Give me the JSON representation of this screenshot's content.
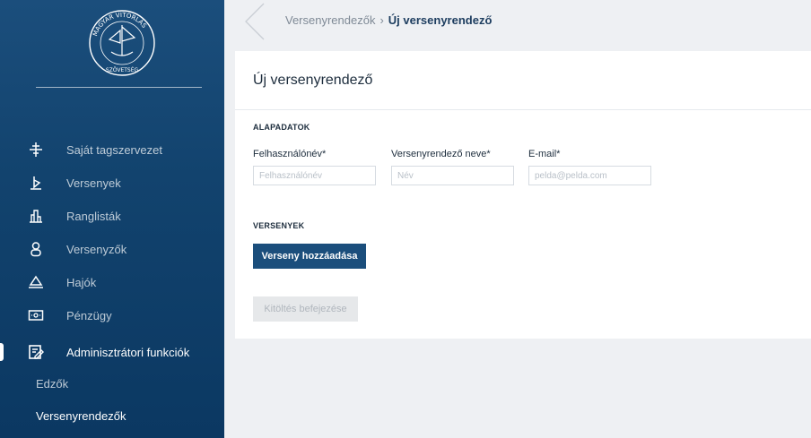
{
  "sidebar": {
    "logo_text": "MAGYAR VITORLÁS SZÖVETSÉG HUNGARIAN YACHTING",
    "items": [
      {
        "label": "Saját tagszervezet",
        "icon": "organization-icon"
      },
      {
        "label": "Versenyek",
        "icon": "sailboat-flag-icon"
      },
      {
        "label": "Ranglisták",
        "icon": "ranking-icon"
      },
      {
        "label": "Versenyzők",
        "icon": "person-icon"
      },
      {
        "label": "Hajók",
        "icon": "boat-icon"
      },
      {
        "label": "Pénzügy",
        "icon": "money-icon"
      },
      {
        "label": "Adminisztrátori funkciók",
        "icon": "edit-document-icon"
      }
    ],
    "subitems": [
      {
        "label": "Edzők"
      },
      {
        "label": "Versenyrendezők"
      }
    ]
  },
  "breadcrumb": {
    "parent": "Versenyrendezők",
    "separator": "›",
    "current": "Új versenyrendező"
  },
  "form": {
    "title": "Új versenyrendező",
    "section_basic": "ALAPADATOK",
    "fields": [
      {
        "label": "Felhasználónév*",
        "placeholder": "Felhasználónév",
        "value": ""
      },
      {
        "label": "Versenyrendező neve*",
        "placeholder": "Név",
        "value": ""
      },
      {
        "label": "E-mail*",
        "placeholder": "pelda@pelda.com",
        "value": ""
      }
    ],
    "section_competitions": "VERSENYEK",
    "add_button": "Verseny hozzáadása",
    "finish_button": "Kitöltés befejezése"
  },
  "colors": {
    "sidebar": "#12436e",
    "primary": "#1b4e7c",
    "page_bg": "#eef0f3"
  }
}
